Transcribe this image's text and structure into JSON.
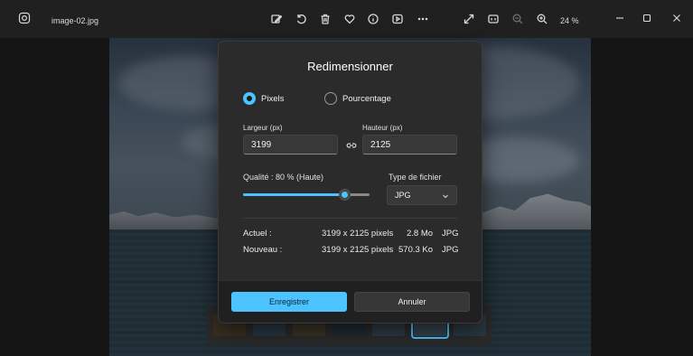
{
  "titlebar": {
    "file_name": "image-02.jpg",
    "zoom_value": "24 %",
    "tools": [
      "edit-image-icon",
      "rotate-icon",
      "delete-icon",
      "favorite-icon",
      "info-icon",
      "slideshow-icon",
      "more-icon",
      "fullscreen-icon",
      "actual-size-icon",
      "zoom-out-icon",
      "zoom-in-icon"
    ]
  },
  "dialog": {
    "title": "Redimensionner",
    "mode_pixels": "Pixels",
    "mode_percent": "Pourcentage",
    "width_label": "Largeur (px)",
    "width_value": "3199",
    "height_label": "Hauteur (px)",
    "height_value": "2125",
    "quality_label": "Qualité : 80 % (Haute)",
    "quality_value": 0.8,
    "filetype_label": "Type de fichier",
    "filetype_value": "JPG",
    "current": {
      "label": "Actuel :",
      "dimensions": "3199 x 2125 pixels",
      "size": "2.8 Mo",
      "format": "JPG"
    },
    "new": {
      "label": "Nouveau :",
      "dimensions": "3199 x 2125 pixels",
      "size": "570.3 Ko",
      "format": "JPG"
    },
    "save_label": "Enregistrer",
    "cancel_label": "Annuler"
  },
  "colors": {
    "accent": "#4cc2ff",
    "dialog_bg": "#2b2b2b",
    "titlebar_bg": "#202020"
  }
}
